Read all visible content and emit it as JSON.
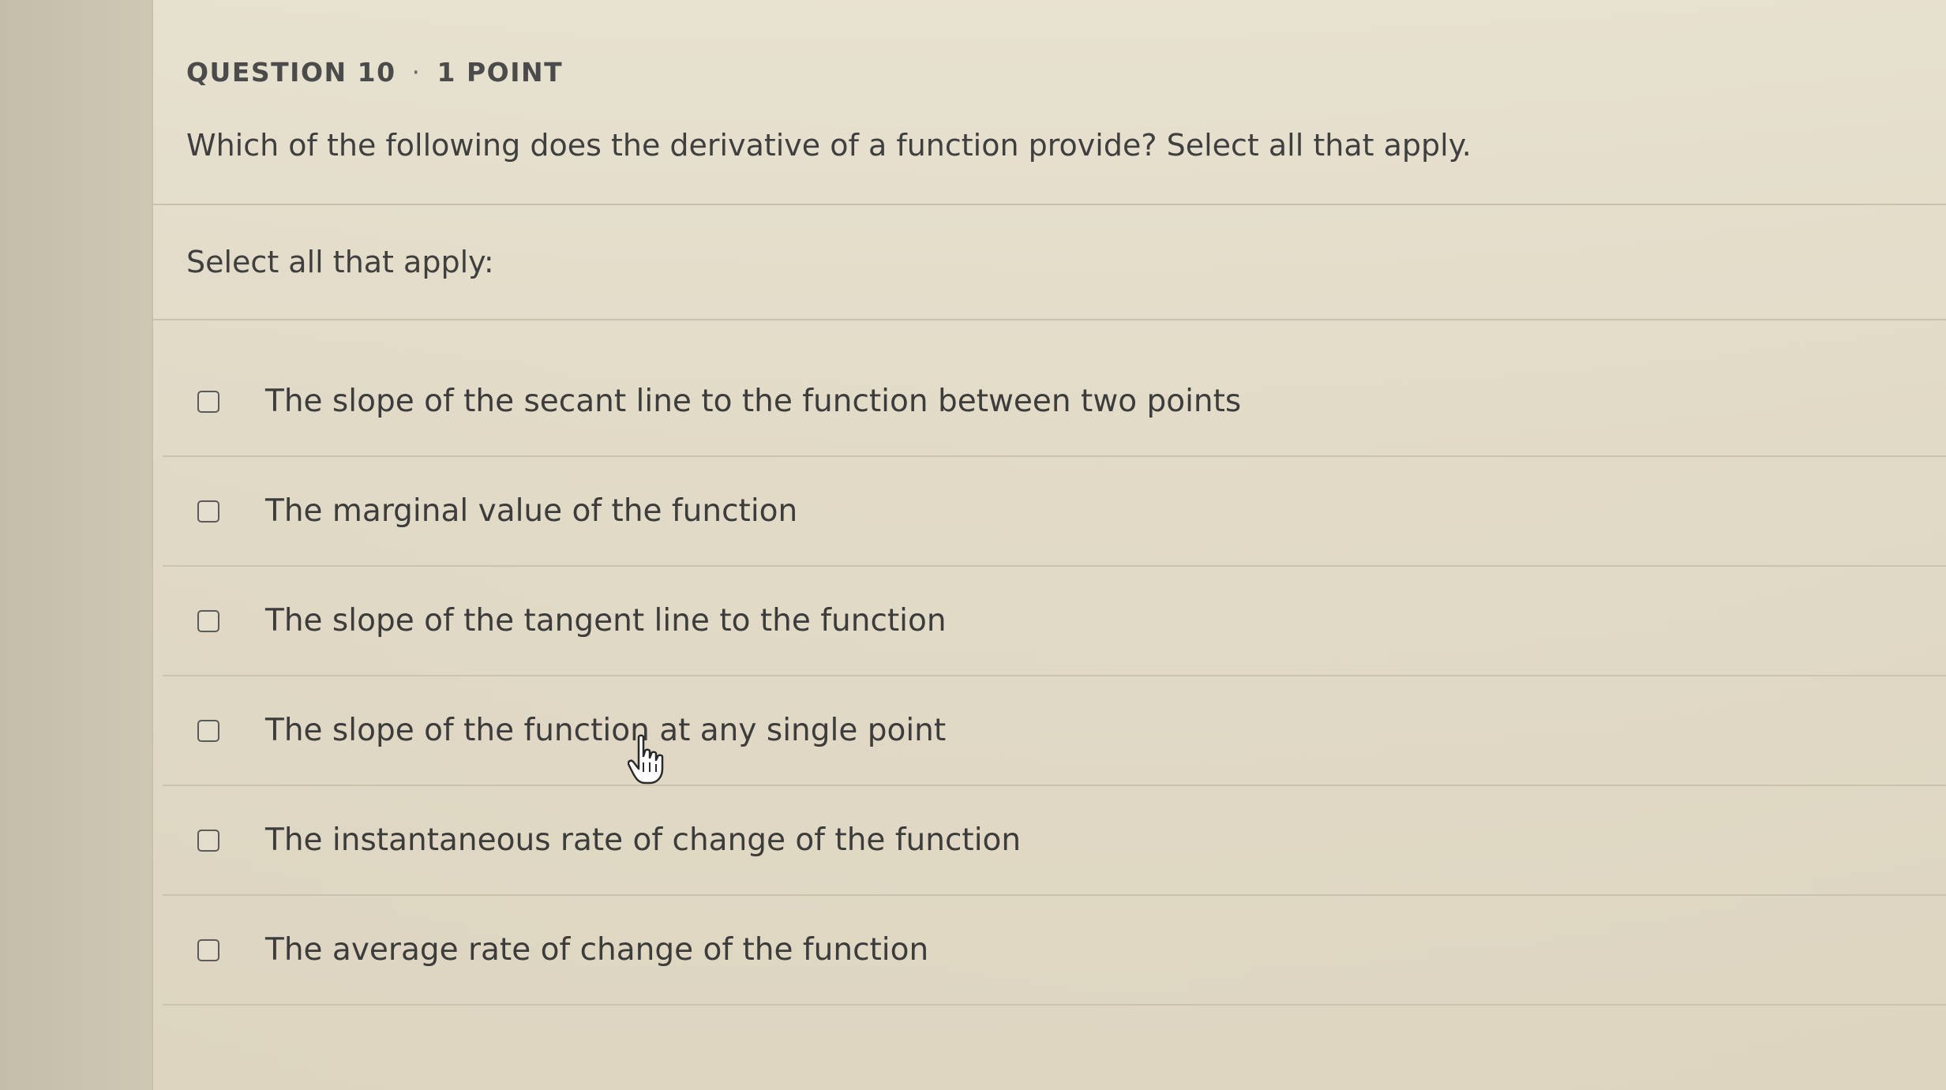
{
  "question": {
    "number_label": "QUESTION 10",
    "separator": "·",
    "points_label": "1 POINT",
    "prompt": "Which of the following does the derivative of a function provide? Select all that apply.",
    "instruction": "Select all that apply:"
  },
  "options": [
    {
      "label": "The slope of the secant line to the function between two points",
      "checked": false
    },
    {
      "label": "The marginal value of the function",
      "checked": false
    },
    {
      "label": "The slope of the tangent line to the function",
      "checked": false
    },
    {
      "label": "The slope of the function at any single point",
      "checked": false
    },
    {
      "label": "The instantaneous rate of change of the function",
      "checked": false
    },
    {
      "label": "The average rate of change of the function",
      "checked": false
    }
  ],
  "icons": {
    "checkbox": "checkbox-empty-icon",
    "cursor": "hand-pointer-icon"
  }
}
